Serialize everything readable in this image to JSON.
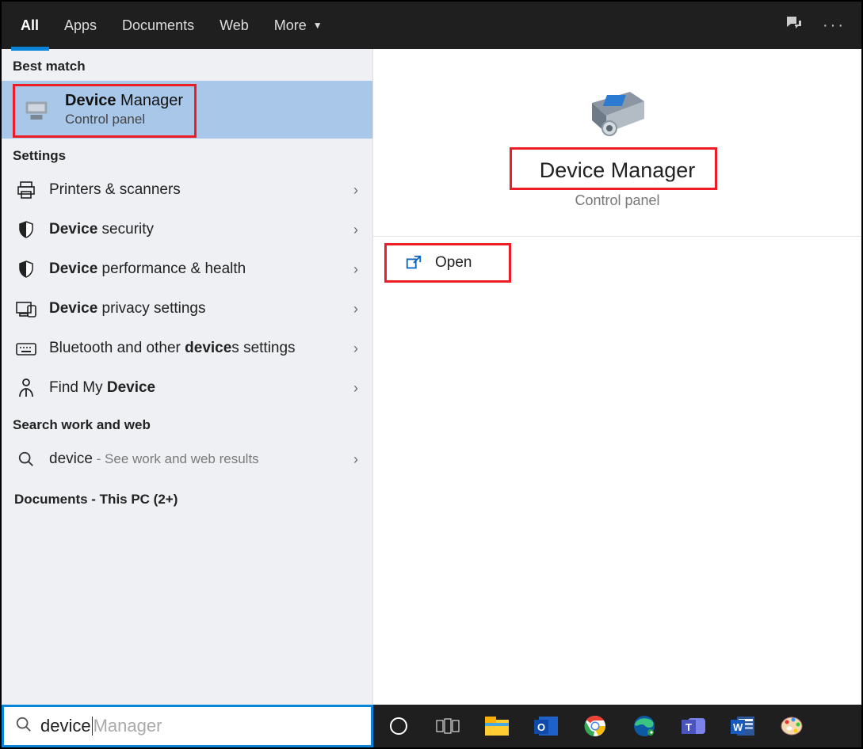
{
  "topbar": {
    "tabs": [
      "All",
      "Apps",
      "Documents",
      "Web",
      "More"
    ],
    "active_index": 0
  },
  "left": {
    "best_match_label": "Best match",
    "best_match": {
      "title_bold": "Device",
      "title_rest": " Manager",
      "subtitle": "Control panel"
    },
    "settings_label": "Settings",
    "settings_items": [
      {
        "icon": "printer",
        "pre": "",
        "bold": "",
        "text": "Printers & scanners"
      },
      {
        "icon": "shield",
        "pre": "",
        "bold": "Device",
        "text": " security"
      },
      {
        "icon": "shield",
        "pre": "",
        "bold": "Device",
        "text": " performance & health"
      },
      {
        "icon": "privacy",
        "pre": "",
        "bold": "Device",
        "text": " privacy settings"
      },
      {
        "icon": "keyboard",
        "pre": "Bluetooth and other ",
        "bold": "device",
        "text": "s settings"
      },
      {
        "icon": "findmy",
        "pre": "Find My ",
        "bold": "Device",
        "text": ""
      }
    ],
    "search_web_label": "Search work and web",
    "search_web": {
      "term": "device",
      "suffix": " - See work and web results"
    },
    "documents_label": "Documents - This PC (2+)"
  },
  "right": {
    "title": "Device Manager",
    "subtitle": "Control panel",
    "open_label": "Open"
  },
  "search": {
    "typed": "device",
    "ghost": "Manager"
  },
  "taskbar": {
    "items": [
      "cortana",
      "taskview",
      "explorer",
      "outlook",
      "chrome",
      "edge",
      "teams",
      "word",
      "paint"
    ]
  }
}
